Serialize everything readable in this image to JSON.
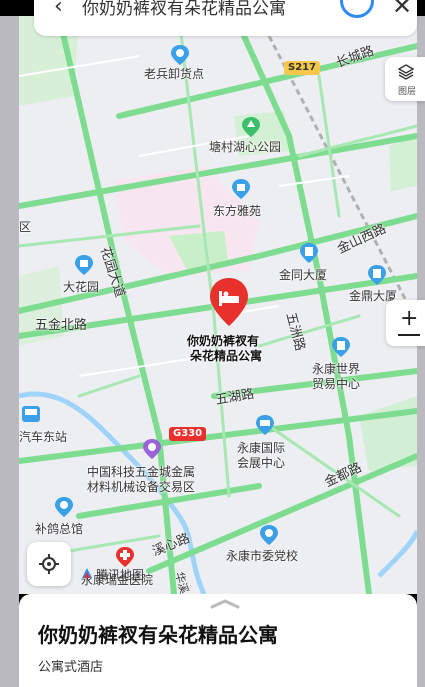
{
  "search": {
    "query": "你奶奶裤衩有朵花精品公寓"
  },
  "map": {
    "pois": {
      "laobing": "老兵卸货点",
      "tangxiang": "塘村湖心公园",
      "dongfang": "东方雅苑",
      "huayuan_poi": "大花园",
      "jintong": "金同大厦",
      "jinding": "金鼎大厦",
      "yongkang_world": "永康世界\n贸易中心",
      "yongkang_expo": "永康国际\n会展中心",
      "china_tech": "中国科技五金城金属\n材料机械设备交易区",
      "bugezong": "补鸽总馆",
      "party_school": "永康市委党校",
      "hospital": "永康瑞金医院",
      "bus_east": "汽车东站",
      "qu": "区"
    },
    "roads": {
      "huayuan_ave": "花园大道",
      "wujin_n": "五金北路",
      "wuhu": "五湖路",
      "wuzhou": "五洲路",
      "jinxi": "金山西路",
      "jindu": "金都路",
      "xixin": "溪心路",
      "changcheng": "长城路",
      "hua": "华溪"
    },
    "badges": {
      "s217": "S217",
      "g330": "G330"
    },
    "selected_poi": {
      "line1": "你奶奶裤衩有",
      "line2": "朵花精品公寓"
    },
    "watermark": "腾讯地图",
    "layers_label": "图层"
  },
  "detail": {
    "name": "你奶奶裤衩有朵花精品公寓",
    "category": "公寓式酒店"
  },
  "colors": {
    "road": "#7ddc8f",
    "road_edge": "#5cc873",
    "park": "#c9efc9",
    "pin_red": "#e8302c",
    "poi_blue": "#3aa0e8",
    "accent_blue": "#2e8cf0"
  }
}
